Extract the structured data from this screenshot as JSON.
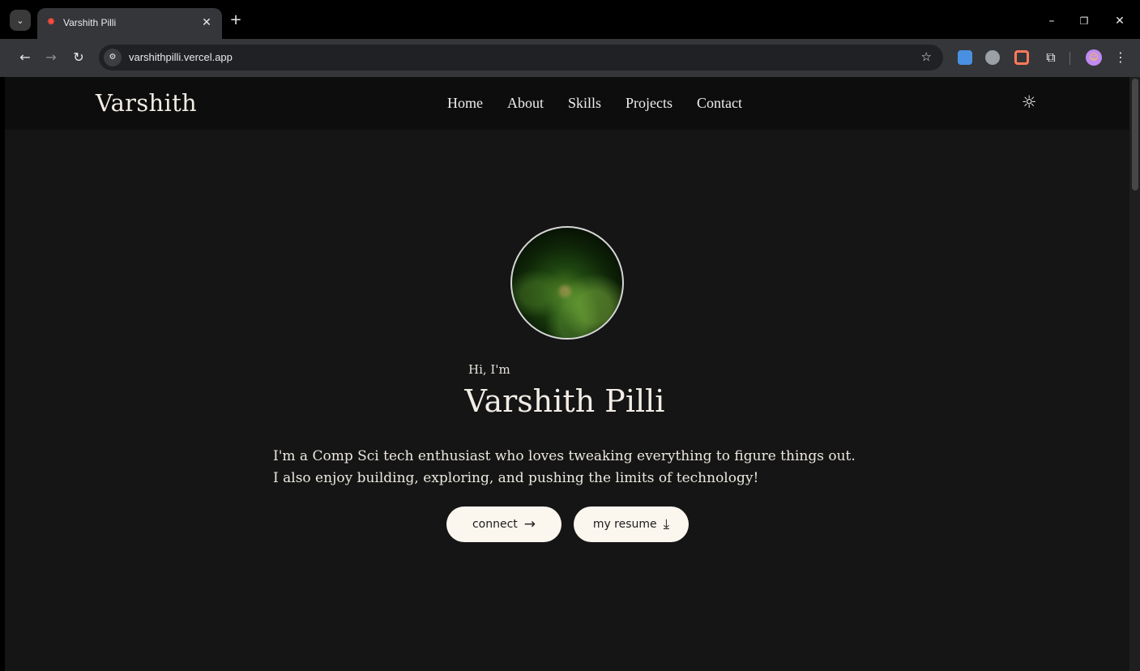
{
  "browser": {
    "tab_title": "Varshith Pilli",
    "tab_favicon": "✸",
    "url": "varshithpilli.vercel.app",
    "window_controls": {
      "minimize": "–",
      "restore": "❐",
      "close": "✕"
    },
    "icons": {
      "tab_menu": "⌄",
      "tab_close": "✕",
      "new_tab": "+",
      "back": "←",
      "forward": "→",
      "reload": "↻",
      "site_info": "⚙",
      "bookmark": "☆",
      "extensions": "⧉",
      "menu": "⋮"
    },
    "extension_colors": [
      "#4a90e2",
      "#9aa0a6",
      "#ff7a59"
    ]
  },
  "site": {
    "brand": "Varshith",
    "nav": [
      "Home",
      "About",
      "Skills",
      "Projects",
      "Contact"
    ],
    "theme_icon": "☼"
  },
  "hero": {
    "greeting": "Hi, I'm",
    "name": "Varshith Pilli",
    "bio_line1": "I'm a Comp Sci tech enthusiast who loves tweaking everything to figure things out.",
    "bio_line2": "I also enjoy building, exploring, and pushing the limits of technology!",
    "connect_label": "connect",
    "connect_icon": "→",
    "resume_label": "my resume",
    "resume_icon": "⤓"
  },
  "colors": {
    "page_bg": "#151515",
    "header_bg": "#0d0d0d",
    "button_bg": "#fbf6ee",
    "text": "#f2ede6"
  }
}
